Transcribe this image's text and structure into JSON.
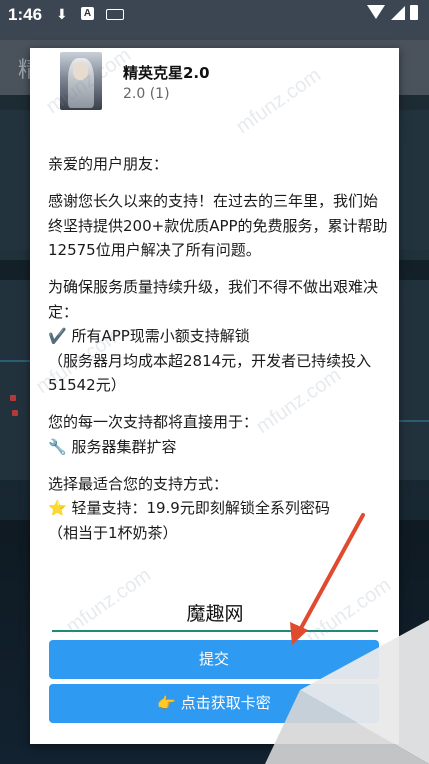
{
  "status_bar": {
    "time": "1:46",
    "download_icon": "download-icon",
    "a_badge": "A",
    "keyboard_icon": "keyboard-icon",
    "wifi_icon": "wifi-icon",
    "signal_icon": "signal-icon",
    "battery_icon": "battery-icon"
  },
  "background": {
    "title": "精"
  },
  "dialog": {
    "app_name": "精英克星2.0",
    "app_version": "2.0 (1)",
    "paragraphs": [
      "亲爱的用户朋友：",
      "感谢您长久以来的支持！在过去的三年里，我们始终坚持提供200+款优质APP的免费服务，累计帮助12575位用户解决了所有问题。",
      "为确保服务质量持续升级，我们不得不做出艰难决定：\n✔️ 所有APP现需小额支持解锁\n（服务器月均成本超2814元，开发者已持续投入51542元）",
      "您的每一次支持都将直接用于：\n🔧 服务器集群扩容",
      "选择最适合您的支持方式：\n⭐ 轻量支持：19.9元即刻解锁全系列密码\n（相当于1杯奶茶）"
    ],
    "code_input_value": "魔趣网",
    "submit_label": "提交",
    "get_code_label": "👉 点击获取卡密"
  },
  "watermark_text": "mfunz.com",
  "colors": {
    "button_bg": "#2e9af2",
    "input_underline": "#1f8a7a",
    "arrow": "#e04a2f"
  }
}
